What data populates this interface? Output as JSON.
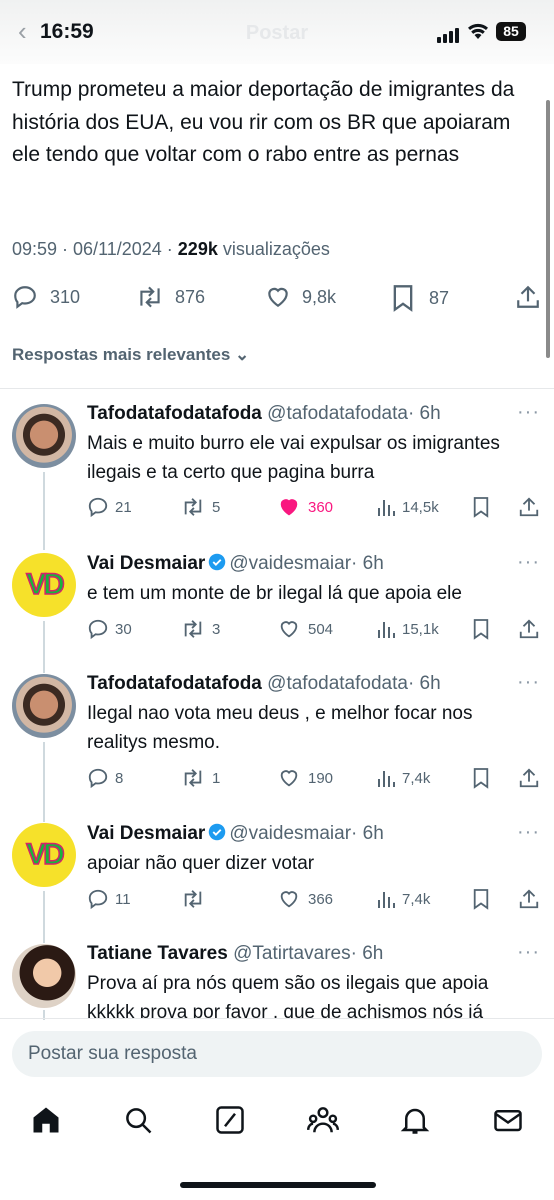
{
  "status_bar": {
    "time": "16:59",
    "battery": "85"
  },
  "header": {
    "title": "Postar"
  },
  "post": {
    "text": "Trump prometeu a maior deportação de imigrantes da história dos EUA, eu vou rir com os BR que apoiaram ele tendo que voltar com o rabo entre as pernas",
    "timestamp": "09:59 · 06/11/2024 · ",
    "views_count": "229k",
    "views_label": " visualizações",
    "replies": "310",
    "reposts": "876",
    "likes": "9,8k",
    "bookmarks": "87"
  },
  "sort_label": "Respostas mais relevantes",
  "replies": [
    {
      "name": "Tafodatafodatafoda",
      "handle": "@tafodatafodata",
      "time": "· 6h",
      "text": "Mais e muito burro ele vai expulsar os imigrantes ilegais e ta certo que pagina burra",
      "replies": "21",
      "reposts": "5",
      "likes": "360",
      "views": "14,5k",
      "liked": true
    },
    {
      "name": "Vai Desmaiar",
      "handle": "@vaidesmaiar",
      "time": "· 6h",
      "text": "e tem um monte de br ilegal lá que apoia ele",
      "replies": "30",
      "reposts": "3",
      "likes": "504",
      "views": "15,1k"
    },
    {
      "name": "Tafodatafodatafoda",
      "handle": "@tafodatafodata",
      "time": "· 6h",
      "text": "Ilegal nao vota meu deus , e melhor focar nos realitys mesmo.",
      "replies": "8",
      "reposts": "1",
      "likes": "190",
      "views": "7,4k"
    },
    {
      "name": "Vai Desmaiar",
      "handle": "@vaidesmaiar",
      "time": "· 6h",
      "text": "apoiar não quer dizer votar",
      "replies": "11",
      "reposts": "",
      "likes": "366",
      "views": "7,4k"
    },
    {
      "name": "Tatiane Tavares",
      "handle": "@Tatirtavares",
      "time": "· 6h",
      "text": "Prova aí pra nós quem são os ilegais que apoia kkkkk prova por favor , que de achismos nós já"
    }
  ],
  "avatar_text": "VD",
  "compose": {
    "placeholder": "Postar sua resposta"
  },
  "colors": {
    "like_active": "#f91880",
    "verified": "#1d9bf0",
    "text_secondary": "#536471"
  },
  "icons": [
    "back-icon",
    "reply-icon",
    "repost-icon",
    "like-icon",
    "bookmark-icon",
    "share-icon",
    "views-icon",
    "more-icon",
    "home-icon",
    "search-icon",
    "grok-icon",
    "communities-icon",
    "notifications-icon",
    "messages-icon"
  ]
}
